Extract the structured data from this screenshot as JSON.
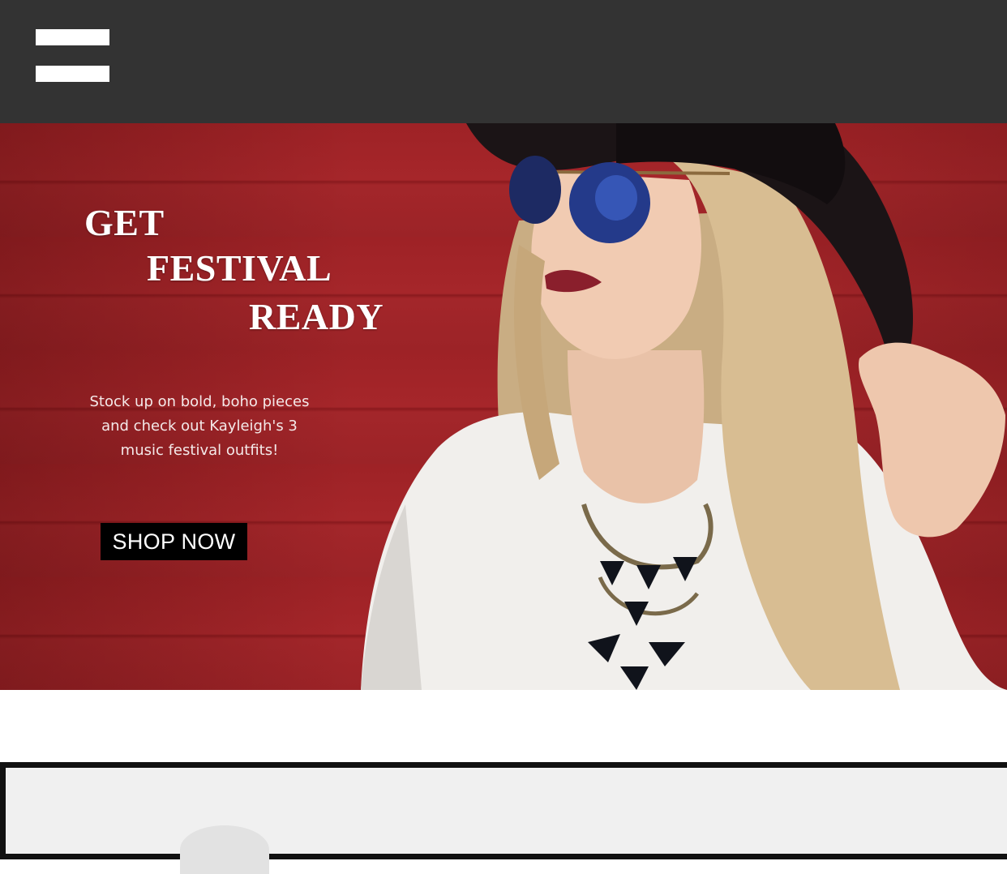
{
  "header": {
    "menu_icon": "hamburger-menu-icon"
  },
  "hero": {
    "headline": [
      "GET",
      "FESTIVAL",
      "READY"
    ],
    "tagline": "Stock up on bold, boho pieces\nand check out Kayleigh's 3\nmusic festival outfits!",
    "cta_label": "SHOP NOW",
    "background_color": "#9e2226"
  },
  "colors": {
    "header_bg": "#333333",
    "button_bg": "#000000",
    "text_light": "#ffffff"
  }
}
